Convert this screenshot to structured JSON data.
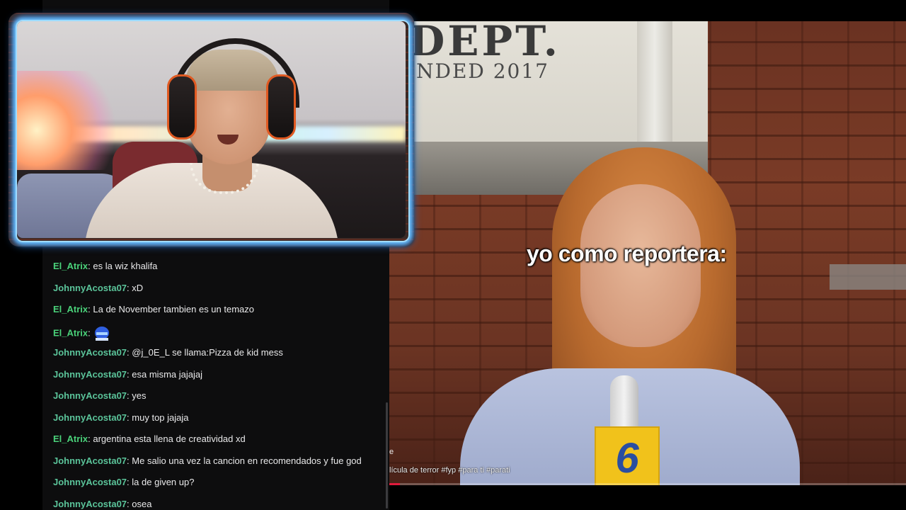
{
  "video": {
    "caption": "yo como reportera:",
    "sign_line_1": "DEPT.",
    "sign_line_2": "NDED 2017",
    "mic_flag_number": "6",
    "description_fragment": "e",
    "description": "lícula de terror #fyp #para ti #parati",
    "progress": 0.02,
    "progress_color": "#e01a3c"
  },
  "chat": {
    "background": "#0d0d0e",
    "text_color": "#e9e9ea",
    "messages": [
      {
        "user": "El_Atrix",
        "color": "#4ad27a",
        "text": "es la wiz khalifa"
      },
      {
        "user": "JohnnyAcosta07",
        "color": "#5bc49a",
        "text": "xD"
      },
      {
        "user": "El_Atrix",
        "color": "#4ad27a",
        "text": "La de November tambien es un temazo"
      },
      {
        "user": "El_Atrix",
        "color": "#4ad27a",
        "text": "",
        "emote": "blue-ghost-emote"
      },
      {
        "user": "JohnnyAcosta07",
        "color": "#5bc49a",
        "text": "@j_0E_L se llama:Pizza de kid mess"
      },
      {
        "user": "JohnnyAcosta07",
        "color": "#5bc49a",
        "text": "esa misma jajajaj"
      },
      {
        "user": "JohnnyAcosta07",
        "color": "#5bc49a",
        "text": "yes"
      },
      {
        "user": "JohnnyAcosta07",
        "color": "#5bc49a",
        "text": "muy top jajaja"
      },
      {
        "user": "El_Atrix",
        "color": "#4ad27a",
        "text": "argentina esta llena de creatividad xd"
      },
      {
        "user": "JohnnyAcosta07",
        "color": "#5bc49a",
        "text": "Me salio una vez la cancion en recomendados y fue god"
      },
      {
        "user": "JohnnyAcosta07",
        "color": "#5bc49a",
        "text": "la de given up?"
      },
      {
        "user": "JohnnyAcosta07",
        "color": "#5bc49a",
        "text": "osea"
      }
    ]
  },
  "webcam": {
    "glow_color": "#6fc3ff",
    "frame_style": "brick"
  }
}
